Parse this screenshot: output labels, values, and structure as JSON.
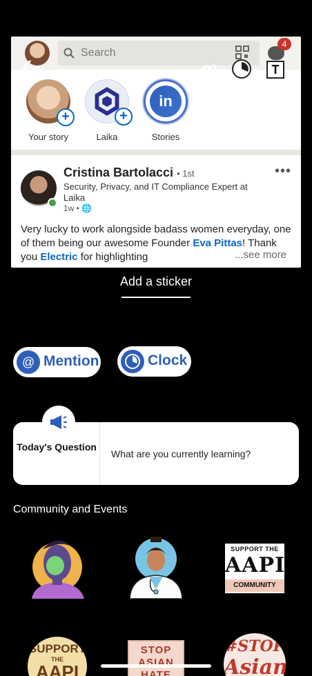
{
  "feed": {
    "search_placeholder": "Search",
    "message_badge": "4",
    "stories": [
      {
        "label": "Your story"
      },
      {
        "label": "Laika"
      },
      {
        "label": "Stories",
        "logo": "in"
      }
    ],
    "post": {
      "author": "Cristina Bartolacci",
      "degree": "• 1st",
      "headline": "Security, Privacy, and IT Compliance Expert at Laika",
      "time": "1w •",
      "text_1": "Very lucky to work alongside badass women everyday, one of them being our awesome Founder ",
      "link_1": "Eva Pittas",
      "text_2": "! Thank you ",
      "link_2": "Electric",
      "text_3": " for highlighting",
      "see_more": "...see more"
    }
  },
  "editor": {
    "text_tool_label": "T"
  },
  "stickers": {
    "title": "Add a sticker",
    "mention_label": "Mention",
    "mention_icon": "@",
    "clock_label": "Clock",
    "question_heading": "Today's Question",
    "question_prompt": "What are you currently learning?",
    "section_title": "Community and Events",
    "items": {
      "aapi_l1": "SUPPORT THE",
      "aapi_l2": "AAPI",
      "aapi_l3": "COMMUNITY",
      "support_l1": "SUPPORT",
      "support_l2": "THE",
      "support_l3": "AAPI",
      "stop_l1": "STOP",
      "stop_l2": "ASIAN",
      "stop_l3": "HATE",
      "hash_l1": "#STOP",
      "hash_l2": "Asian"
    }
  },
  "colors": {
    "accent": "#2e5fb8",
    "link": "#0a66c2",
    "badge": "#c6362c",
    "background": "#000000"
  },
  "icons": [
    "back-arrow-icon",
    "link-icon",
    "clock-icon",
    "text-icon",
    "search-icon",
    "qr-code-icon",
    "messaging-icon",
    "megaphone-icon",
    "at-icon",
    "globe-icon",
    "more-icon"
  ]
}
